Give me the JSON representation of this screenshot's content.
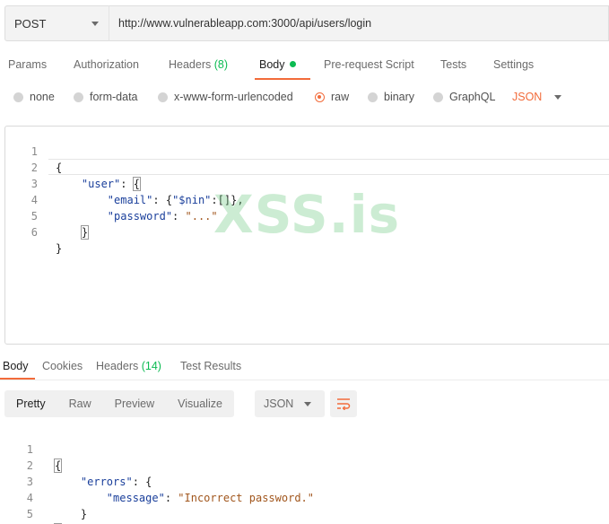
{
  "request": {
    "method": "POST",
    "url": "http://www.vulnerableapp.com:3000/api/users/login"
  },
  "request_tabs": [
    {
      "label": "Params"
    },
    {
      "label": "Authorization"
    },
    {
      "label": "Headers",
      "count": "(8)"
    },
    {
      "label": "Body"
    },
    {
      "label": "Pre-request Script"
    },
    {
      "label": "Tests"
    },
    {
      "label": "Settings"
    }
  ],
  "body_types": [
    {
      "label": "none"
    },
    {
      "label": "form-data"
    },
    {
      "label": "x-www-form-urlencoded"
    },
    {
      "label": "raw"
    },
    {
      "label": "binary"
    },
    {
      "label": "GraphQL"
    }
  ],
  "body_format": "JSON",
  "request_body": {
    "line_numbers": [
      "1",
      "2",
      "3",
      "4",
      "5",
      "6"
    ],
    "open_brace": "{",
    "user_key": "\"user\"",
    "colon_space": ": ",
    "user_open": "{",
    "email_key": "\"email\"",
    "email_open": ": {",
    "nin_key": "\"$nin\"",
    "nin_value": ":[]},",
    "password_key": "\"password\"",
    "password_value": "\"...\"",
    "user_close": "}",
    "close_brace": "}"
  },
  "watermark": "XSS.is",
  "response_tabs": [
    {
      "label": "Body"
    },
    {
      "label": "Cookies"
    },
    {
      "label": "Headers",
      "count": "(14)"
    },
    {
      "label": "Test Results"
    }
  ],
  "response_views": [
    "Pretty",
    "Raw",
    "Preview",
    "Visualize"
  ],
  "response_format": "JSON",
  "response_body": {
    "line_numbers": [
      "1",
      "2",
      "3",
      "4",
      "5"
    ],
    "open_brace": "{",
    "errors_key": "\"errors\"",
    "errors_open": ": {",
    "message_key": "\"message\"",
    "colon_space": ": ",
    "message_value": "\"Incorrect password.\"",
    "errors_close": "}",
    "close_brace": "}"
  },
  "colors": {
    "accent": "#f26b3a",
    "success": "#0cbb52",
    "key": "#1a3f9b",
    "string": "#a1561d"
  }
}
